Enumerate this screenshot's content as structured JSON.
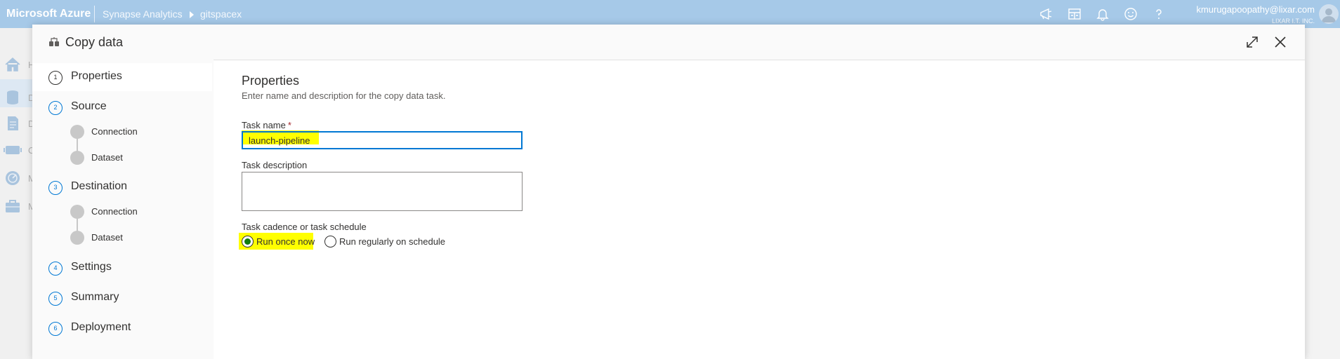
{
  "topbar": {
    "brand": "Microsoft Azure",
    "breadcrumb": [
      "Synapse Analytics",
      "gitspacex"
    ],
    "icons": [
      "announcement-icon",
      "switch-directory-icon",
      "notifications-bell-icon",
      "feedback-smiley-icon",
      "help-icon"
    ],
    "user_email": "kmurugapoopathy@lixar.com",
    "user_org": "LIXAR I.T. INC."
  },
  "bg_nav": {
    "items": [
      {
        "icon": "home-icon",
        "label": "H"
      },
      {
        "icon": "data-icon",
        "label": "D"
      },
      {
        "icon": "develop-icon",
        "label": "D"
      },
      {
        "icon": "orchestrate-icon",
        "label": "O"
      },
      {
        "icon": "monitor-icon",
        "label": "M"
      },
      {
        "icon": "manage-icon",
        "label": "M"
      }
    ]
  },
  "dialog": {
    "title": "Copy data",
    "title_icon": "copy-data-icon",
    "buttons": [
      "expand-icon",
      "close-icon"
    ]
  },
  "wizard": {
    "steps": [
      {
        "num": "1",
        "label": "Properties",
        "active": true,
        "subs": []
      },
      {
        "num": "2",
        "label": "Source",
        "active": false,
        "subs": [
          "Connection",
          "Dataset"
        ]
      },
      {
        "num": "3",
        "label": "Destination",
        "active": false,
        "subs": [
          "Connection",
          "Dataset"
        ]
      },
      {
        "num": "4",
        "label": "Settings",
        "active": false,
        "subs": []
      },
      {
        "num": "5",
        "label": "Summary",
        "active": false,
        "subs": []
      },
      {
        "num": "6",
        "label": "Deployment",
        "active": false,
        "subs": []
      }
    ]
  },
  "properties": {
    "title": "Properties",
    "subtitle": "Enter name and description for the copy data task.",
    "task_name_label": "Task name",
    "required_marker": "*",
    "task_name_value": "launch-pipeline",
    "task_description_label": "Task description",
    "task_description_value": "",
    "cadence_label": "Task cadence or task schedule",
    "cadence_options": [
      {
        "label": "Run once now",
        "selected": true
      },
      {
        "label": "Run regularly on schedule",
        "selected": false
      }
    ]
  },
  "colors": {
    "topbar": "#a6c9e8",
    "accent": "#0078d4",
    "highlight": "#ffff00",
    "radio_selected": "#107c10"
  }
}
